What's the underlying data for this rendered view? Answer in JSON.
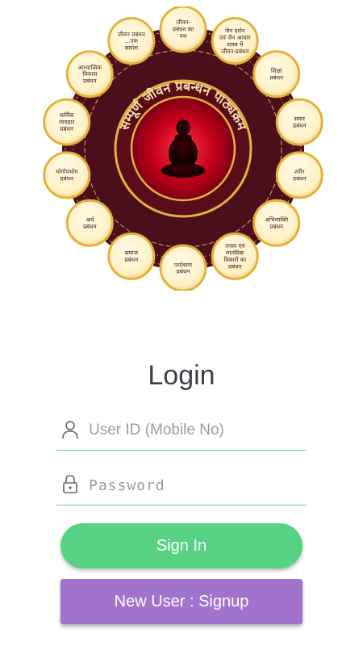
{
  "emblem": {
    "ring_text": "सम्पूर्ण जीवन प्रबन्धन पाठ्यक्रम",
    "petals": [
      [
        "जीवन-",
        "प्रबंधन का",
        "पथ"
      ],
      [
        "जैन दर्शन",
        "एवं जैन आचार",
        "शास्त्र में",
        "जीवन-प्रबंधन"
      ],
      [
        "शिक्षा",
        "प्रबंधन"
      ],
      [
        "समय",
        "प्रबंधन"
      ],
      [
        "शरीर",
        "प्रबंधन"
      ],
      [
        "अभिव्यक्ति",
        "प्रबंधन"
      ],
      [
        "तनाव एवं",
        "मानसिक",
        "विकारों का",
        "प्रबंधन"
      ],
      [
        "पर्यावरण",
        "प्रबंधन"
      ],
      [
        "समाज",
        "प्रबंधन"
      ],
      [
        "अर्थ",
        "प्रबंधन"
      ],
      [
        "भोगोपभोग",
        "प्रबंधन"
      ],
      [
        "धार्मिक",
        "व्यवहार",
        "प्रबंधन"
      ],
      [
        "आध्यात्मिक",
        "विकास",
        "प्रबंधन"
      ],
      [
        "जीवन प्रबंधन",
        "...एक",
        "सारांश"
      ]
    ]
  },
  "login": {
    "title": "Login",
    "userid_placeholder": "User ID (Mobile No)",
    "password_placeholder": "Password",
    "signin_label": "Sign In",
    "signup_label": "New User : Signup"
  },
  "colors": {
    "accent_green": "#57d183",
    "signup_purple": "#a173cc",
    "emblem_maroon": "#4a0f1a",
    "emblem_gold": "#e3b23c"
  },
  "icons": {
    "userid": "user-icon",
    "password": "lock-icon"
  }
}
